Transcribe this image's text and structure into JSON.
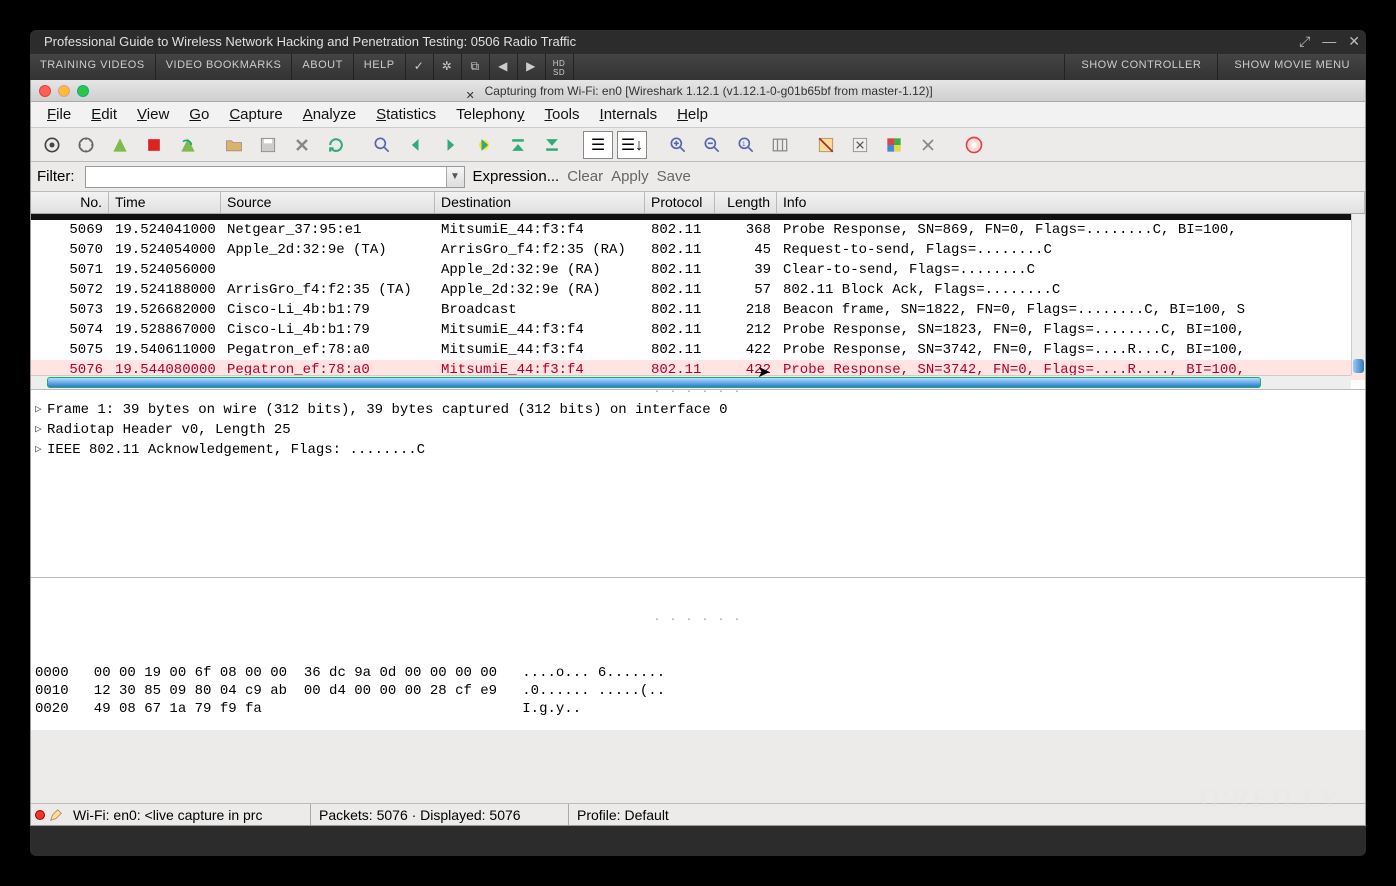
{
  "video": {
    "title": "Professional Guide to Wireless Network Hacking and Penetration Testing: 0506 Radio Traffic",
    "tabs": [
      "TRAINING VIDEOS",
      "VIDEO BOOKMARKS",
      "ABOUT",
      "HELP"
    ],
    "right_buttons": [
      "SHOW CONTROLLER",
      "SHOW MOVIE MENU"
    ]
  },
  "mac_title": "Capturing from Wi-Fi: en0   [Wireshark 1.12.1  (v1.12.1-0-g01b65bf from master-1.12)]",
  "menus": [
    "File",
    "Edit",
    "View",
    "Go",
    "Capture",
    "Analyze",
    "Statistics",
    "Telephony",
    "Tools",
    "Internals",
    "Help"
  ],
  "toolbar_icons": [
    "list-icon",
    "gear-icon",
    "fin-icon",
    "stop-icon",
    "restart-icon",
    "sep",
    "open-icon",
    "save-icon",
    "close-icon",
    "reload-icon",
    "sep",
    "find-icon",
    "back-icon",
    "forward-icon",
    "jump-icon",
    "up-icon",
    "down-icon",
    "sep",
    "details-icon",
    "bytes-icon",
    "sep",
    "zoom-in-icon",
    "zoom-out-icon",
    "zoom-fit-icon",
    "resize-cols-icon",
    "sep",
    "capture-filter-icon",
    "display-filter-icon",
    "coloring-icon",
    "prefs-icon",
    "sep",
    "help-icon"
  ],
  "filterbar": {
    "label": "Filter:",
    "value": "",
    "expression": "Expression...",
    "clear": "Clear",
    "apply": "Apply",
    "save": "Save"
  },
  "columns": [
    "No.",
    "Time",
    "Source",
    "Destination",
    "Protocol",
    "Length",
    "Info"
  ],
  "packets": [
    {
      "no": "5069",
      "time": "19.524041000",
      "src": "Netgear_37:95:e1",
      "dst": "MitsumiE_44:f3:f4",
      "proto": "802.11",
      "len": "368",
      "info": "Probe Response, SN=869, FN=0, Flags=........C, BI=100,"
    },
    {
      "no": "5070",
      "time": "19.524054000",
      "src": "Apple_2d:32:9e (TA)",
      "dst": "ArrisGro_f4:f2:35 (RA)",
      "proto": "802.11",
      "len": "45",
      "info": "Request-to-send, Flags=........C"
    },
    {
      "no": "5071",
      "time": "19.524056000",
      "src": "",
      "dst": "Apple_2d:32:9e (RA)",
      "proto": "802.11",
      "len": "39",
      "info": "Clear-to-send, Flags=........C"
    },
    {
      "no": "5072",
      "time": "19.524188000",
      "src": "ArrisGro_f4:f2:35 (TA)",
      "dst": "Apple_2d:32:9e (RA)",
      "proto": "802.11",
      "len": "57",
      "info": "802.11 Block Ack, Flags=........C"
    },
    {
      "no": "5073",
      "time": "19.526682000",
      "src": "Cisco-Li_4b:b1:79",
      "dst": "Broadcast",
      "proto": "802.11",
      "len": "218",
      "info": "Beacon frame, SN=1822, FN=0, Flags=........C, BI=100, S"
    },
    {
      "no": "5074",
      "time": "19.528867000",
      "src": "Cisco-Li_4b:b1:79",
      "dst": "MitsumiE_44:f3:f4",
      "proto": "802.11",
      "len": "212",
      "info": "Probe Response, SN=1823, FN=0, Flags=........C, BI=100,"
    },
    {
      "no": "5075",
      "time": "19.540611000",
      "src": "Pegatron_ef:78:a0",
      "dst": "MitsumiE_44:f3:f4",
      "proto": "802.11",
      "len": "422",
      "info": "Probe Response, SN=3742, FN=0, Flags=....R...C, BI=100,"
    },
    {
      "no": "5076",
      "time": "19.544080000",
      "src": "Pegatron_ef:78:a0",
      "dst": "MitsumiE_44:f3:f4",
      "proto": "802.11",
      "len": "422",
      "info": "Probe Response, SN=3742, FN=0, Flags=....R...., BI=100,",
      "selected": true
    }
  ],
  "details": [
    "Frame 1: 39 bytes on wire (312 bits), 39 bytes captured (312 bits) on interface 0",
    "Radiotap Header v0, Length 25",
    "IEEE 802.11 Acknowledgement, Flags: ........C"
  ],
  "hex": [
    {
      "off": "0000",
      "bytes": "00 00 19 00 6f 08 00 00  36 dc 9a 0d 00 00 00 00",
      "ascii": "....o... 6......."
    },
    {
      "off": "0010",
      "bytes": "12 30 85 09 80 04 c9 ab  00 d4 00 00 00 28 cf e9",
      "ascii": ".0...... .....(.."
    },
    {
      "off": "0020",
      "bytes": "49 08 67 1a 79 f9 fa",
      "ascii": "I.g.y.."
    }
  ],
  "status": {
    "iface": "Wi-Fi: en0: <live capture in prc",
    "packets": "Packets: 5076 · Displayed: 5076",
    "profile": "Profile: Default"
  },
  "watermark": "O'REILLY"
}
